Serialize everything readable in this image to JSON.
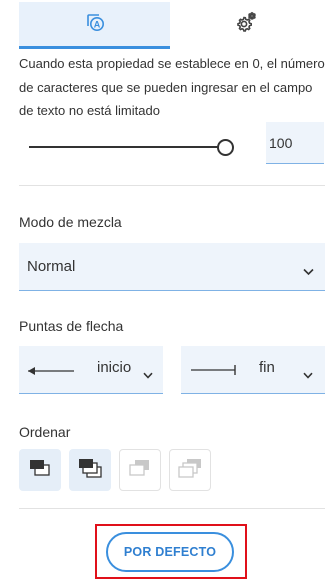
{
  "tabs": [
    {
      "icon": "text-field-a-icon",
      "active": true
    },
    {
      "icon": "gear-icon",
      "active": false
    }
  ],
  "description": "Cuando esta propiedad se establece en 0, el número de caracteres que se pueden ingresar en el campo de texto no está limitado",
  "max_length": {
    "slider_fraction": 1.0,
    "value": "100"
  },
  "blend_mode": {
    "label": "Modo de mezcla",
    "value": "Normal"
  },
  "arrowheads": {
    "label": "Puntas de flecha",
    "start_value": "inicio",
    "end_value": "fin"
  },
  "order": {
    "label": "Ordenar",
    "buttons": [
      {
        "icon": "bring-forward-icon",
        "enabled": true
      },
      {
        "icon": "bring-to-front-icon",
        "enabled": true
      },
      {
        "icon": "send-backward-icon",
        "enabled": false
      },
      {
        "icon": "send-to-back-icon",
        "enabled": false
      }
    ]
  },
  "default_button_label": "POR DEFECTO",
  "colors": {
    "accent": "#3a8fde",
    "field_bg": "#eef4fb",
    "highlight": "#e0101a"
  }
}
